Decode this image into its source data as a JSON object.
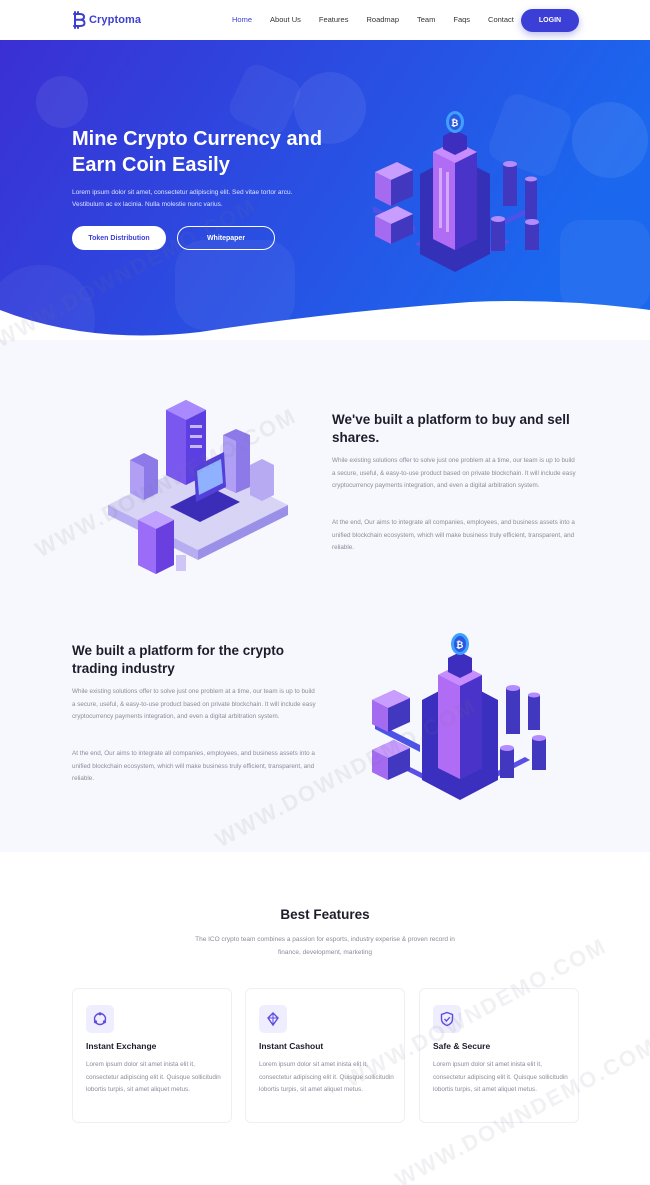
{
  "brand": {
    "name": "Cryptoma",
    "color": "#3b3fd5"
  },
  "nav": {
    "items": [
      {
        "label": "Home",
        "active": true
      },
      {
        "label": "About Us"
      },
      {
        "label": "Features"
      },
      {
        "label": "Roadmap"
      },
      {
        "label": "Team"
      },
      {
        "label": "Faqs"
      },
      {
        "label": "Contact"
      }
    ],
    "login_label": "LOGIN"
  },
  "hero": {
    "title": "Mine Crypto Currency and Earn Coin Easily",
    "description": "Lorem ipsum dolor sit amet, consectetur adipiscing elit. Sed vitae tortor arcu. Vestibulum ac ex lacinia. Nulla molestie nunc varius.",
    "primary_button": "Token Distribution",
    "secondary_button": "Whitepaper",
    "gradient": [
      "#3f2fd6",
      "#1c6af0"
    ]
  },
  "section_platform": {
    "title": "We've built a platform to buy and sell shares.",
    "paragraph1": "While existing solutions offer to solve just one problem at a time, our team is up to build a secure, useful, & easy-to-use product based on private blockchain. It will include easy cryptocurrency payments integration, and even a digital arbitration system.",
    "paragraph2": "At the end, Our aims to integrate all companies, employees, and business assets into a unified blockchain ecosystem, which will make business truly efficient, transparent, and reliable."
  },
  "section_industry": {
    "title": "We built a platform for the crypto trading industry",
    "paragraph1": "While existing solutions offer to solve just one problem at a time, our team is up to build a secure, useful, & easy-to-use product based on private blockchain. It will include easy cryptocurrency payments integration, and even a digital arbitration system.",
    "paragraph2": "At the end, Our aims to integrate all companies, employees, and business assets into a unified blockchain ecosystem, which will make business truly efficient, transparent, and reliable."
  },
  "features": {
    "title": "Best Features",
    "subtitle": "The ICO crypto team combines a passion for esports, industry experise & proven record in finance, development, marketing",
    "cards": [
      {
        "icon": "exchange-icon",
        "title": "Instant Exchange",
        "text": "Lorem ipsum dolor sit amet inista elit it, consectetur adipiscing elit it. Quisque sollicitudin lobortis turpis, sit amet aliquet metus."
      },
      {
        "icon": "cashout-icon",
        "title": "Instant Cashout",
        "text": "Lorem ipsum dolor sit amet inista elit it, consectetur adipiscing elit it. Quisque sollicitudin lobortis turpis, sit amet aliquet metus."
      },
      {
        "icon": "shield-icon",
        "title": "Safe & Secure",
        "text": "Lorem ipsum dolor sit amet inista elit it, consectetur adipiscing elit it. Quisque sollicitudin lobortis turpis, sit amet aliquet metus."
      }
    ]
  },
  "watermark": "WWW.DOWNDEMO.COM"
}
